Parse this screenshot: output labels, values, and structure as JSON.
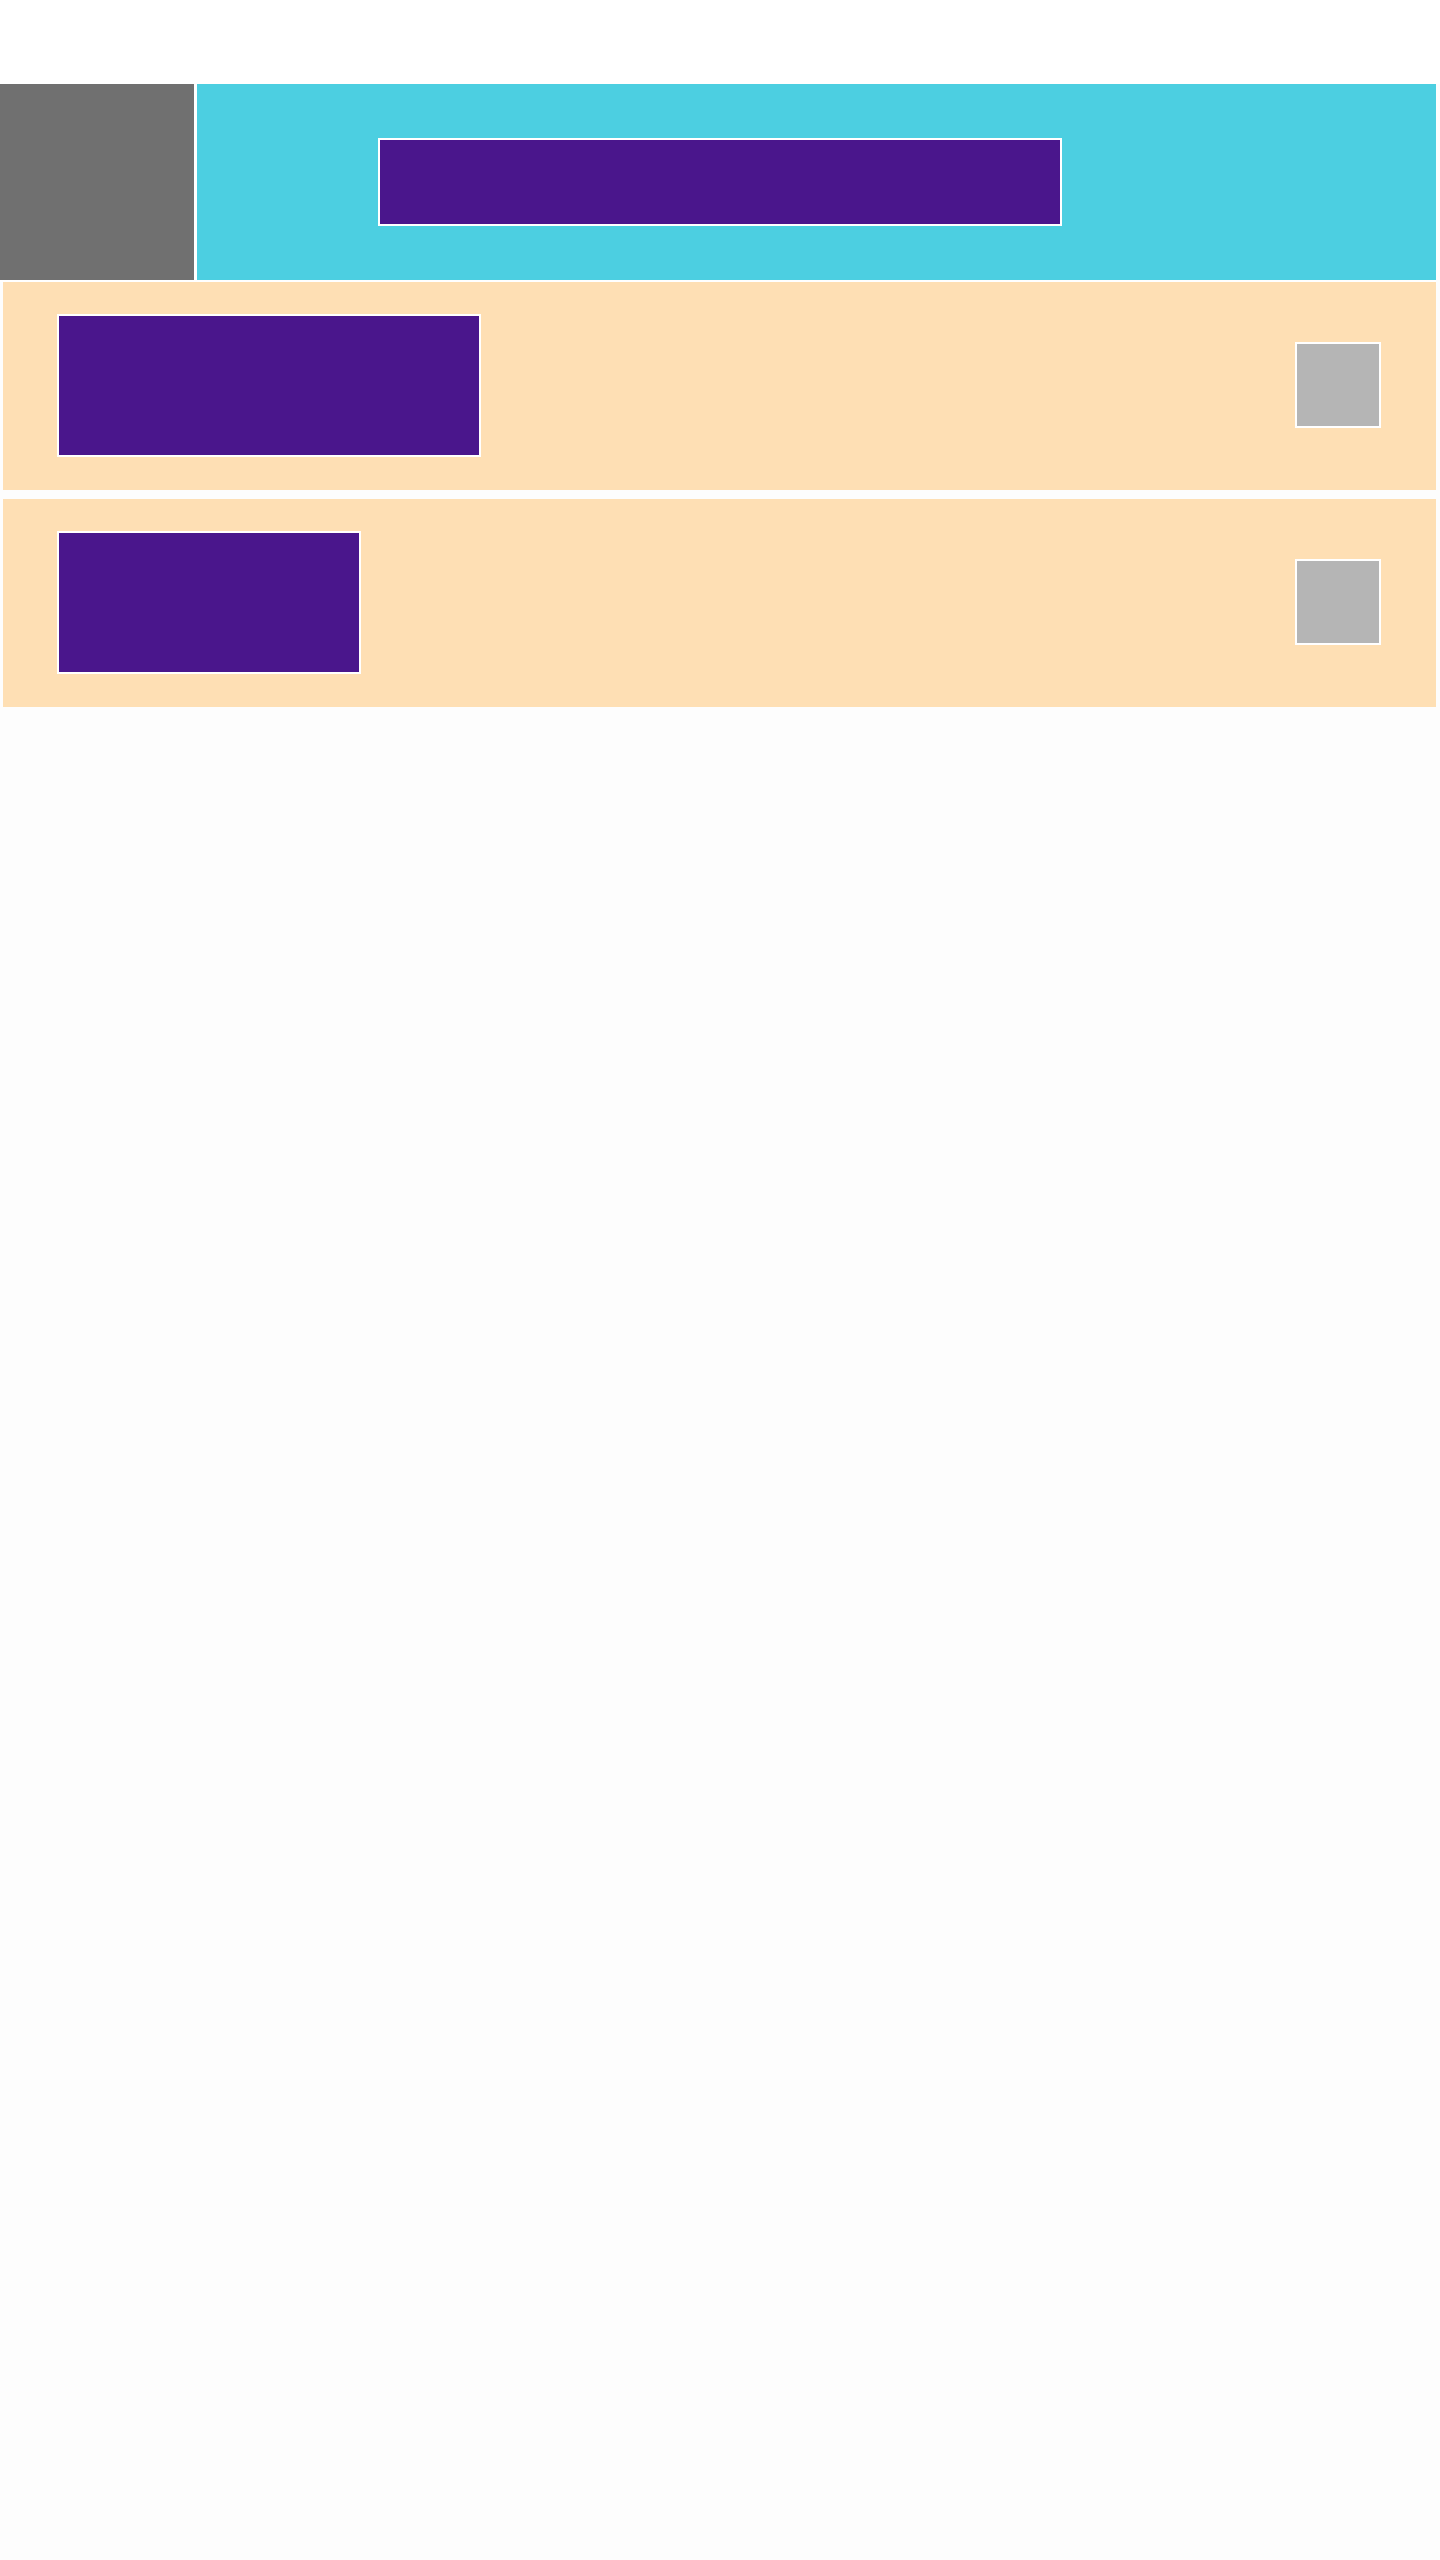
{
  "toolbar": {
    "title": ""
  },
  "list": {
    "items": [
      {
        "label": "",
        "checked": false
      },
      {
        "label": "",
        "checked": false
      }
    ]
  },
  "colors": {
    "toolbar": "#4ccfe1",
    "nav_button": "#707070",
    "text_block": "#4a168c",
    "list_item": "#fedfb4",
    "checkbox": "#b5b5b5",
    "background": "#fdfdfd"
  },
  "icons": {
    "nav": "navigation-icon",
    "checkbox": "checkbox-icon"
  }
}
